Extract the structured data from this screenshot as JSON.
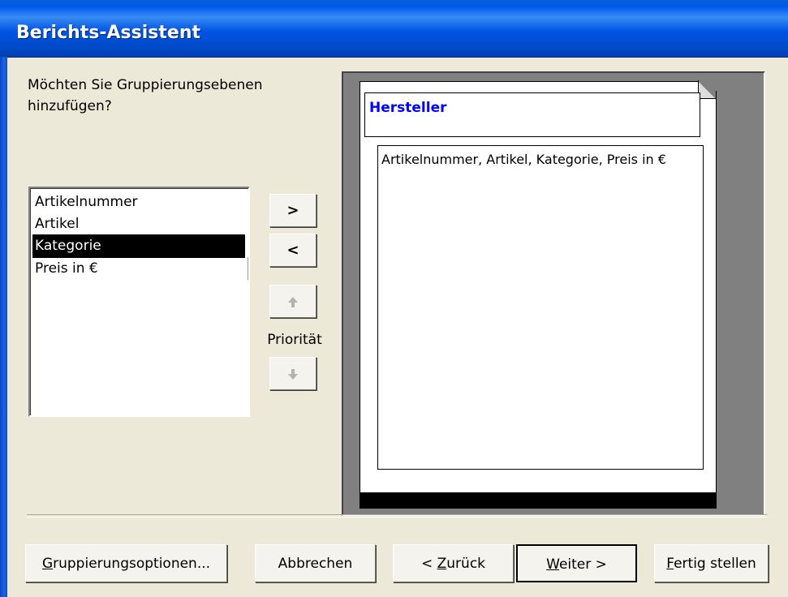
{
  "window": {
    "title": "Berichts-Assistent"
  },
  "question": "Möchten Sie Gruppierungsebenen hinzufügen?",
  "fields": [
    {
      "label": "Artikelnummer",
      "selected": false
    },
    {
      "label": "Artikel",
      "selected": false
    },
    {
      "label": "Kategorie",
      "selected": true
    },
    {
      "label": "Preis in €",
      "selected": false
    }
  ],
  "buttons": {
    "add": ">",
    "remove": "<",
    "priority_label": "Priorität"
  },
  "preview": {
    "group_header": "Hersteller",
    "detail_fields": "Artikelnummer, Artikel, Kategorie, Preis in €"
  },
  "footer": {
    "grouping_options": {
      "accel": "G",
      "rest": "ruppierungsoptionen..."
    },
    "cancel": "Abbrechen",
    "back": {
      "prefix": "< ",
      "accel": "Z",
      "rest": "urück"
    },
    "next": {
      "accel": "W",
      "rest": "eiter >"
    },
    "finish": {
      "accel": "F",
      "rest": "ertig stellen"
    }
  },
  "colors": {
    "titlebar": "#0054E3",
    "group_header_text": "#0000FF",
    "selection": "#000000"
  }
}
